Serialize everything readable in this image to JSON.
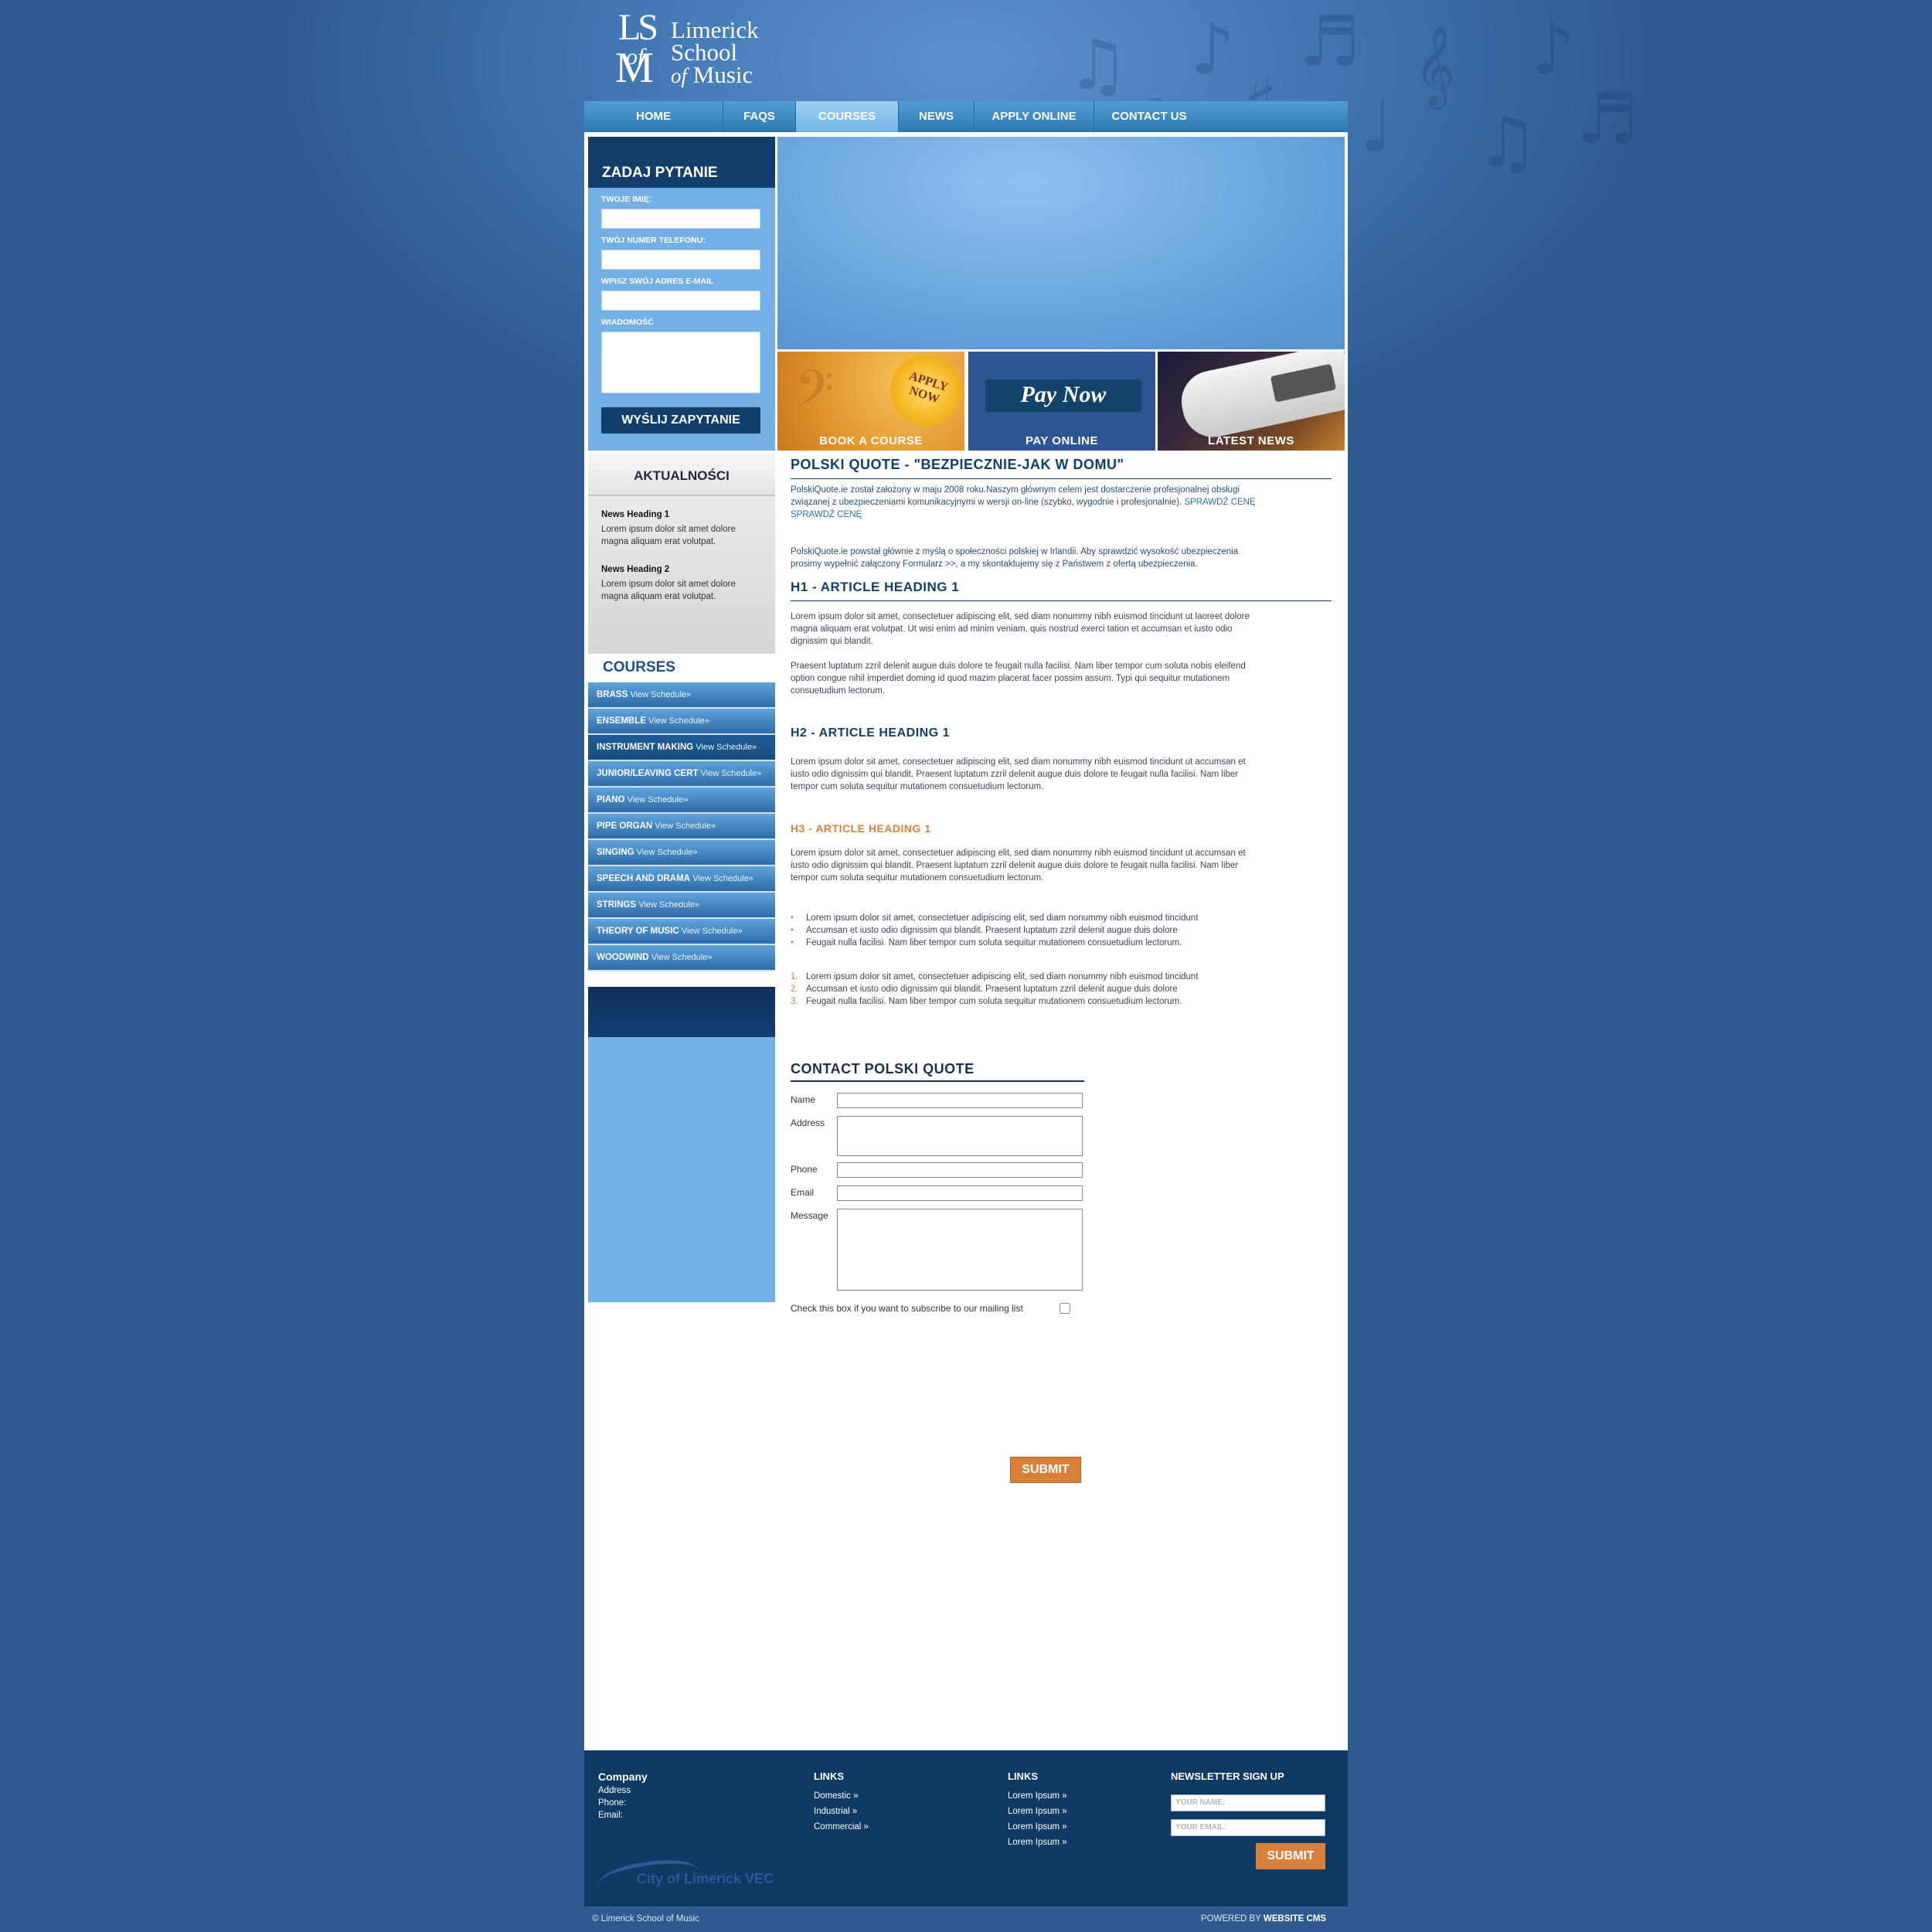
{
  "logo": {
    "monogram_ls": "LS",
    "monogram_of": "of",
    "monogram_m": "M",
    "line1": "Limerick",
    "line2": "School",
    "line3_of": "of",
    "line3_music": "Music"
  },
  "nav": {
    "items": [
      {
        "label": "HOME"
      },
      {
        "label": "FAQS"
      },
      {
        "label": "COURSES",
        "active": true
      },
      {
        "label": "NEWS"
      },
      {
        "label": "APPLY ONLINE"
      },
      {
        "label": "CONTACT US"
      }
    ]
  },
  "ask_form": {
    "title": "ZADAJ PYTANIE",
    "name_label": "TWOJE IMIĘ:",
    "phone_label": "TWÓJ NUMER TELEFONU:",
    "email_label": "WPISZ SWÓJ ADRES E-MAIL",
    "message_label": "WIADOMOŚĆ",
    "submit_label": "WYŚLIJ ZAPYTANIE"
  },
  "news": {
    "title": "AKTUALNOŚCI",
    "items": [
      {
        "heading": "News Heading 1",
        "text": "Lorem ipsum dolor sit amet dolore magna aliquam erat volutpat."
      },
      {
        "heading": "News Heading 2",
        "text": "Lorem ipsum dolor sit amet dolore magna aliquam erat volutpat."
      }
    ]
  },
  "courses": {
    "title": "COURSES",
    "link_suffix": "View Schedule»",
    "items": [
      {
        "name": "BRASS"
      },
      {
        "name": "ENSEMBLE"
      },
      {
        "name": "INSTRUMENT MAKING",
        "active": true
      },
      {
        "name": "JUNIOR/LEAVING CERT"
      },
      {
        "name": "PIANO"
      },
      {
        "name": "PIPE ORGAN"
      },
      {
        "name": "SINGING"
      },
      {
        "name": "SPEECH AND DRAMA"
      },
      {
        "name": "STRINGS"
      },
      {
        "name": "THEORY OF MUSIC"
      },
      {
        "name": "WOODWIND"
      }
    ]
  },
  "promos": {
    "book": {
      "label": "BOOK A COURSE",
      "badge_line1": "APPLY",
      "badge_line2": "NOW"
    },
    "pay": {
      "label": "PAY ONLINE",
      "banner": "Pay Now"
    },
    "news": {
      "label": "LATEST NEWS"
    }
  },
  "content": {
    "title": "POLSKI QUOTE - \"BEZPIECZNIE-JAK W DOMU\"",
    "intro1": "PolskiQuote.ie został założony w maju 2008 roku.Naszym głównym celem jest dostarczenie profesjonalnej obsługi związanej z ubezpieczeniami komunikacyjnymi w wersji on-line (szybko, wygodnie i profesjonalnie).",
    "intro1_link": "SPRAWDŹ CENĘ SPRAWDŹ CENĘ",
    "intro2": "PolskiQuote.ie powstał głównie z myślą o społeczności polskiej w Irlandii. Aby sprawdzić wysokość ubezpieczenia prosimy wypełnić załączony Formularz >>, a my skontaktujemy się z Państwem z ofertą ubezpieczenia.",
    "h1": "H1 - ARTICLE HEADING 1",
    "h1_p1": "Lorem ipsum dolor sit amet, consectetuer adipiscing elit, sed diam nonummy nibh euismod tincidunt ut laoreet dolore magna aliquam erat volutpat. Ut wisi enim ad minim veniam, quis nostrud exerci tation et accumsan et iusto odio dignissim qui blandit.",
    "h1_p2": "Praesent luptatum zzril delenit augue duis dolore te feugait nulla facilisi. Nam liber tempor cum soluta nobis eleifend option congue nihil imperdiet doming id quod mazim placerat facer possim assum. Typi qui sequitur mutationem consuetudium lectorum.",
    "h2": "H2 - ARTICLE HEADING 1",
    "h2_p": "Lorem ipsum dolor sit amet, consectetuer adipiscing elit, sed diam nonummy nibh euismod tincidunt ut accumsan et iusto odio dignissim qui blandit. Praesent luptatum zzril delenit augue duis dolore te feugait nulla facilisi. Nam liber tempor cum soluta sequitur mutationem consuetudium lectorum.",
    "h3": "H3 - ARTICLE HEADING 1",
    "h3_p": "Lorem ipsum dolor sit amet, consectetuer adipiscing elit, sed diam nonummy nibh euismod tincidunt ut accumsan et iusto odio dignissim qui blandit. Praesent luptatum zzril delenit augue duis dolore te feugait nulla facilisi. Nam liber tempor cum soluta sequitur mutationem consuetudium lectorum.",
    "bullets": [
      "Lorem ipsum dolor sit amet, consectetuer adipiscing elit, sed diam nonummy nibh euismod tincidunt",
      "Accumsan et iusto odio dignissim qui blandit. Praesent luptatum zzril delenit augue duis dolore",
      "Feugait nulla facilisi. Nam liber tempor cum soluta sequitur mutationem consuetudium lectorum."
    ],
    "numbered": [
      {
        "num": "1.",
        "text": "Lorem ipsum dolor sit amet, consectetuer adipiscing elit, sed diam nonummy nibh euismod tincidunt"
      },
      {
        "num": "2.",
        "text": "Accumsan et iusto odio dignissim qui blandit. Praesent luptatum zzril delenit augue duis dolore"
      },
      {
        "num": "3.",
        "text": "Feugait nulla facilisi. Nam liber tempor cum soluta sequitur mutationem consuetudium lectorum."
      }
    ]
  },
  "contact_form": {
    "title": "CONTACT POLSKI QUOTE",
    "name_label": "Name",
    "address_label": "Address",
    "phone_label": "Phone",
    "email_label": "Email",
    "message_label": "Message",
    "checkbox_label": "Check this box if you want to subscribe to our mailing list",
    "submit_label": "SUBMIT"
  },
  "footer": {
    "company_title": "Company",
    "address_label": "Address",
    "phone_label": "Phone:",
    "email_label": "Email:",
    "links1_title": "LINKS",
    "links1": [
      "Domestic »",
      "Industrial »",
      "Commercial »"
    ],
    "links2_title": "LINKS",
    "links2": [
      "Lorem Ipsum »",
      "Lorem Ipsum »",
      "Lorem Ipsum »",
      "Lorem Ipsum »"
    ],
    "newsletter_title": "NEWSLETTER SIGN UP",
    "name_placeholder": "YOUR NAME:",
    "email_placeholder": "YOUR EMAIL:",
    "submit_label": "SUBMIT",
    "vec_logo": "City of Limerick VEC"
  },
  "bottom": {
    "copyright": "© Limerick School of Music",
    "powered_prefix": "POWERED BY",
    "powered_brand": "WEBSITE CMS"
  },
  "colors": {
    "background": "#2f5a90",
    "nav": "#2f78b0",
    "dark_navy": "#123e6a",
    "light_blue": "#74b0e6",
    "accent_orange": "#d8803a"
  }
}
